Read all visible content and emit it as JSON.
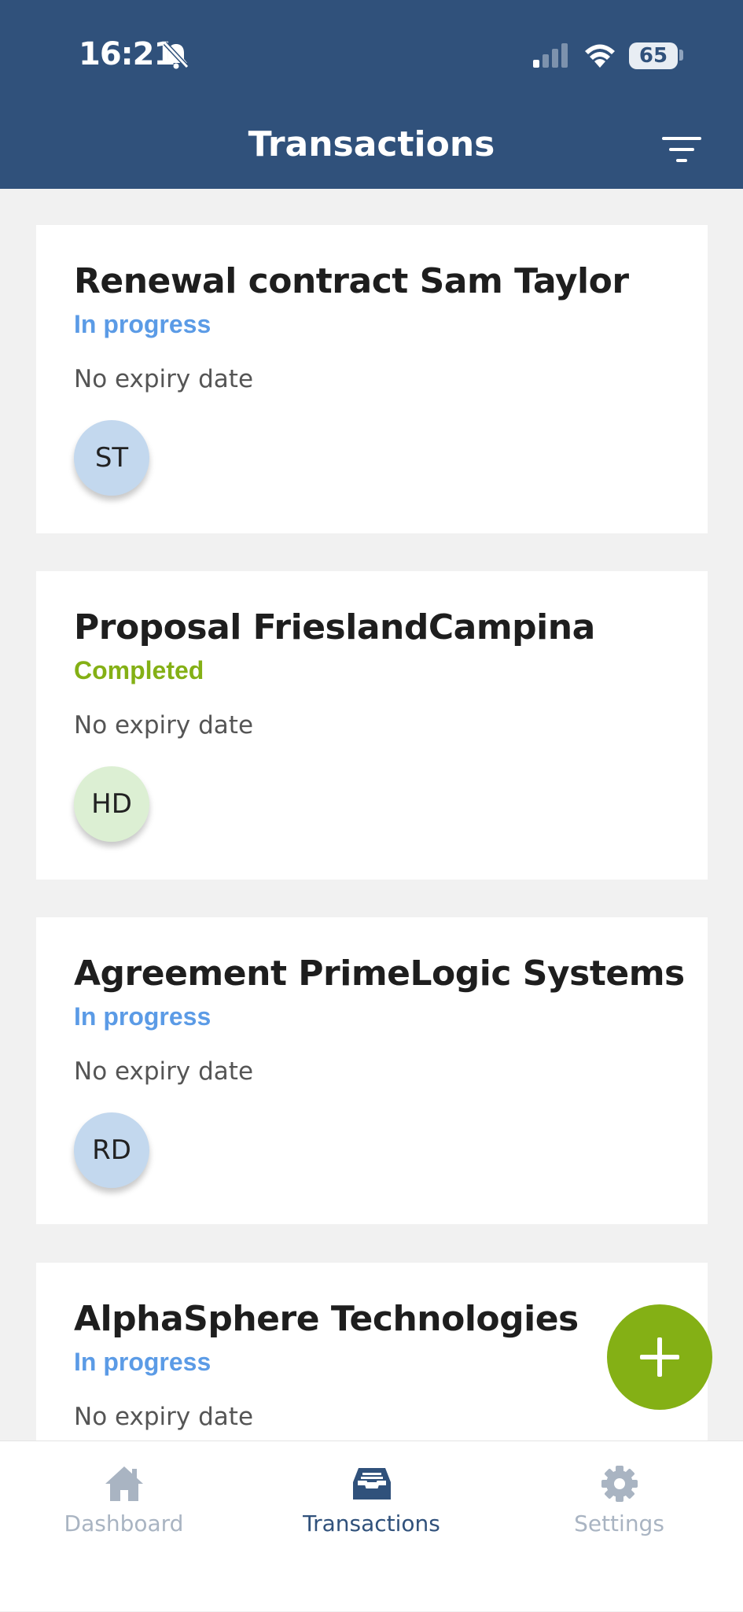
{
  "status_bar": {
    "time": "16:21",
    "battery": "65"
  },
  "header": {
    "title": "Transactions"
  },
  "transactions": [
    {
      "title": "Renewal contract Sam Taylor",
      "status": "In progress",
      "status_color": "#5b9be6",
      "expiry": "No expiry date",
      "avatar": "ST",
      "avatar_color": "#c3d8ee"
    },
    {
      "title": "Proposal FrieslandCampina",
      "status": "Completed",
      "status_color": "#84b015",
      "expiry": "No expiry date",
      "avatar": "HD",
      "avatar_color": "#dcefd3"
    },
    {
      "title": "Agreement PrimeLogic Systems",
      "status": "In progress",
      "status_color": "#5b9be6",
      "expiry": "No expiry date",
      "avatar": "RD",
      "avatar_color": "#c3d8ee"
    },
    {
      "title": "AlphaSphere Technologies",
      "status": "In progress",
      "status_color": "#5b9be6",
      "expiry": "No expiry date",
      "avatar": "",
      "avatar_color": "#c3d8ee"
    }
  ],
  "fab": {
    "icon": "plus-icon",
    "color": "#84b015"
  },
  "tabbar": {
    "active_color": "#30517b",
    "inactive_color": "#a9b4c2",
    "tabs": [
      {
        "label": "Dashboard",
        "icon": "home-icon",
        "active": false
      },
      {
        "label": "Transactions",
        "icon": "inbox-icon",
        "active": true
      },
      {
        "label": "Settings",
        "icon": "gear-icon",
        "active": false
      }
    ]
  }
}
